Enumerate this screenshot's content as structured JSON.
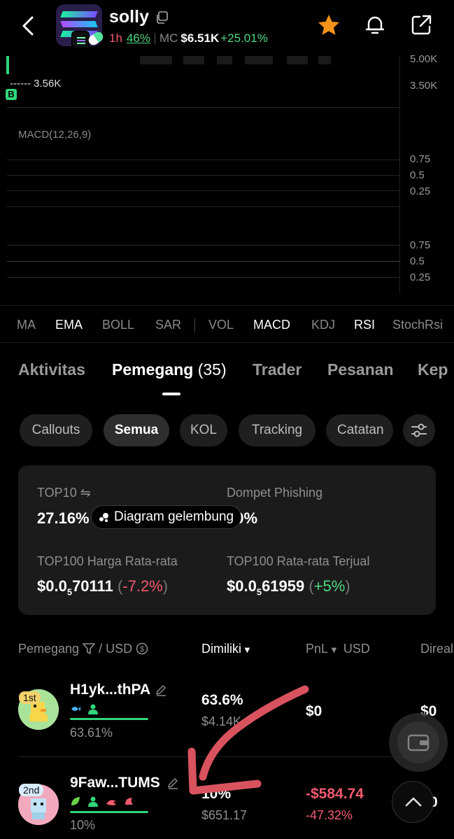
{
  "header": {
    "token_name": "solly",
    "timeframe": "1h",
    "timeframe_pct": "46%",
    "mc_label": "MC",
    "mc_value": "$6.51K",
    "mc_change": "+25.01%",
    "colors": {
      "accent_green": "#4fd880",
      "accent_red": "#f25a6e",
      "star": "#f7931a"
    }
  },
  "chart": {
    "y_ticks_top": [
      "5.00K",
      "3.50K"
    ],
    "price_marker": "------ 3.56K",
    "buy_marker": "B",
    "macd_label": "MACD(12,26,9)",
    "macd_ticks": [
      "0.75",
      "0.5",
      "0.25"
    ],
    "rsi_ticks": [
      "0.75",
      "0.5",
      "0.25"
    ]
  },
  "indicators": [
    "MA",
    "EMA",
    "BOLL",
    "SAR",
    "VOL",
    "MACD",
    "KDJ",
    "RSI",
    "StochRsi"
  ],
  "indicators_active": [
    "EMA",
    "MACD",
    "RSI"
  ],
  "tabs": {
    "aktivitas": "Aktivitas",
    "pemegang": "Pemegang",
    "pemegang_count": "(35)",
    "trader": "Trader",
    "pesanan": "Pesanan",
    "kep": "Kep"
  },
  "chips": {
    "callouts": "Callouts",
    "semua": "Semua",
    "kol": "KOL",
    "tracking": "Tracking",
    "catatan": "Catatan"
  },
  "stats": {
    "top10_label": "TOP10 ⇋",
    "top10_value": "27.16%",
    "bubble_label": "Diagram gelembung",
    "phishing_label": "Dompet Phishing",
    "phishing_value": "10%",
    "avg_price_label": "TOP100 Harga Rata-rata",
    "avg_price_prefix": "$0.0",
    "avg_price_sub": "5",
    "avg_price_rest": "70111",
    "avg_price_change": "-7.2%",
    "avg_sold_label": "TOP100 Rata-rata Terjual",
    "avg_sold_prefix": "$0.0",
    "avg_sold_sub": "5",
    "avg_sold_rest": "61959",
    "avg_sold_change": "+5%"
  },
  "table": {
    "col_holder": "Pemegang",
    "col_usd": "/ USD",
    "col_owned": "Dimiliki",
    "col_pnl": "PnL",
    "col_pnl_usd": "USD",
    "col_realized": "Direal"
  },
  "holders": [
    {
      "rank": "1st",
      "address": "H1yk...thPA",
      "pct_sub": "63.61%",
      "owned_pct": "63.6%",
      "owned_usd": "$4.14K",
      "pnl": "$0",
      "realized": "$0"
    },
    {
      "rank": "2nd",
      "address": "9Faw...TUMS",
      "pct_sub": "10%",
      "owned_pct": "10%",
      "owned_usd": "$651.17",
      "pnl": "-$584.74",
      "pnl_pct": "-47.32%",
      "realized": "0"
    }
  ]
}
